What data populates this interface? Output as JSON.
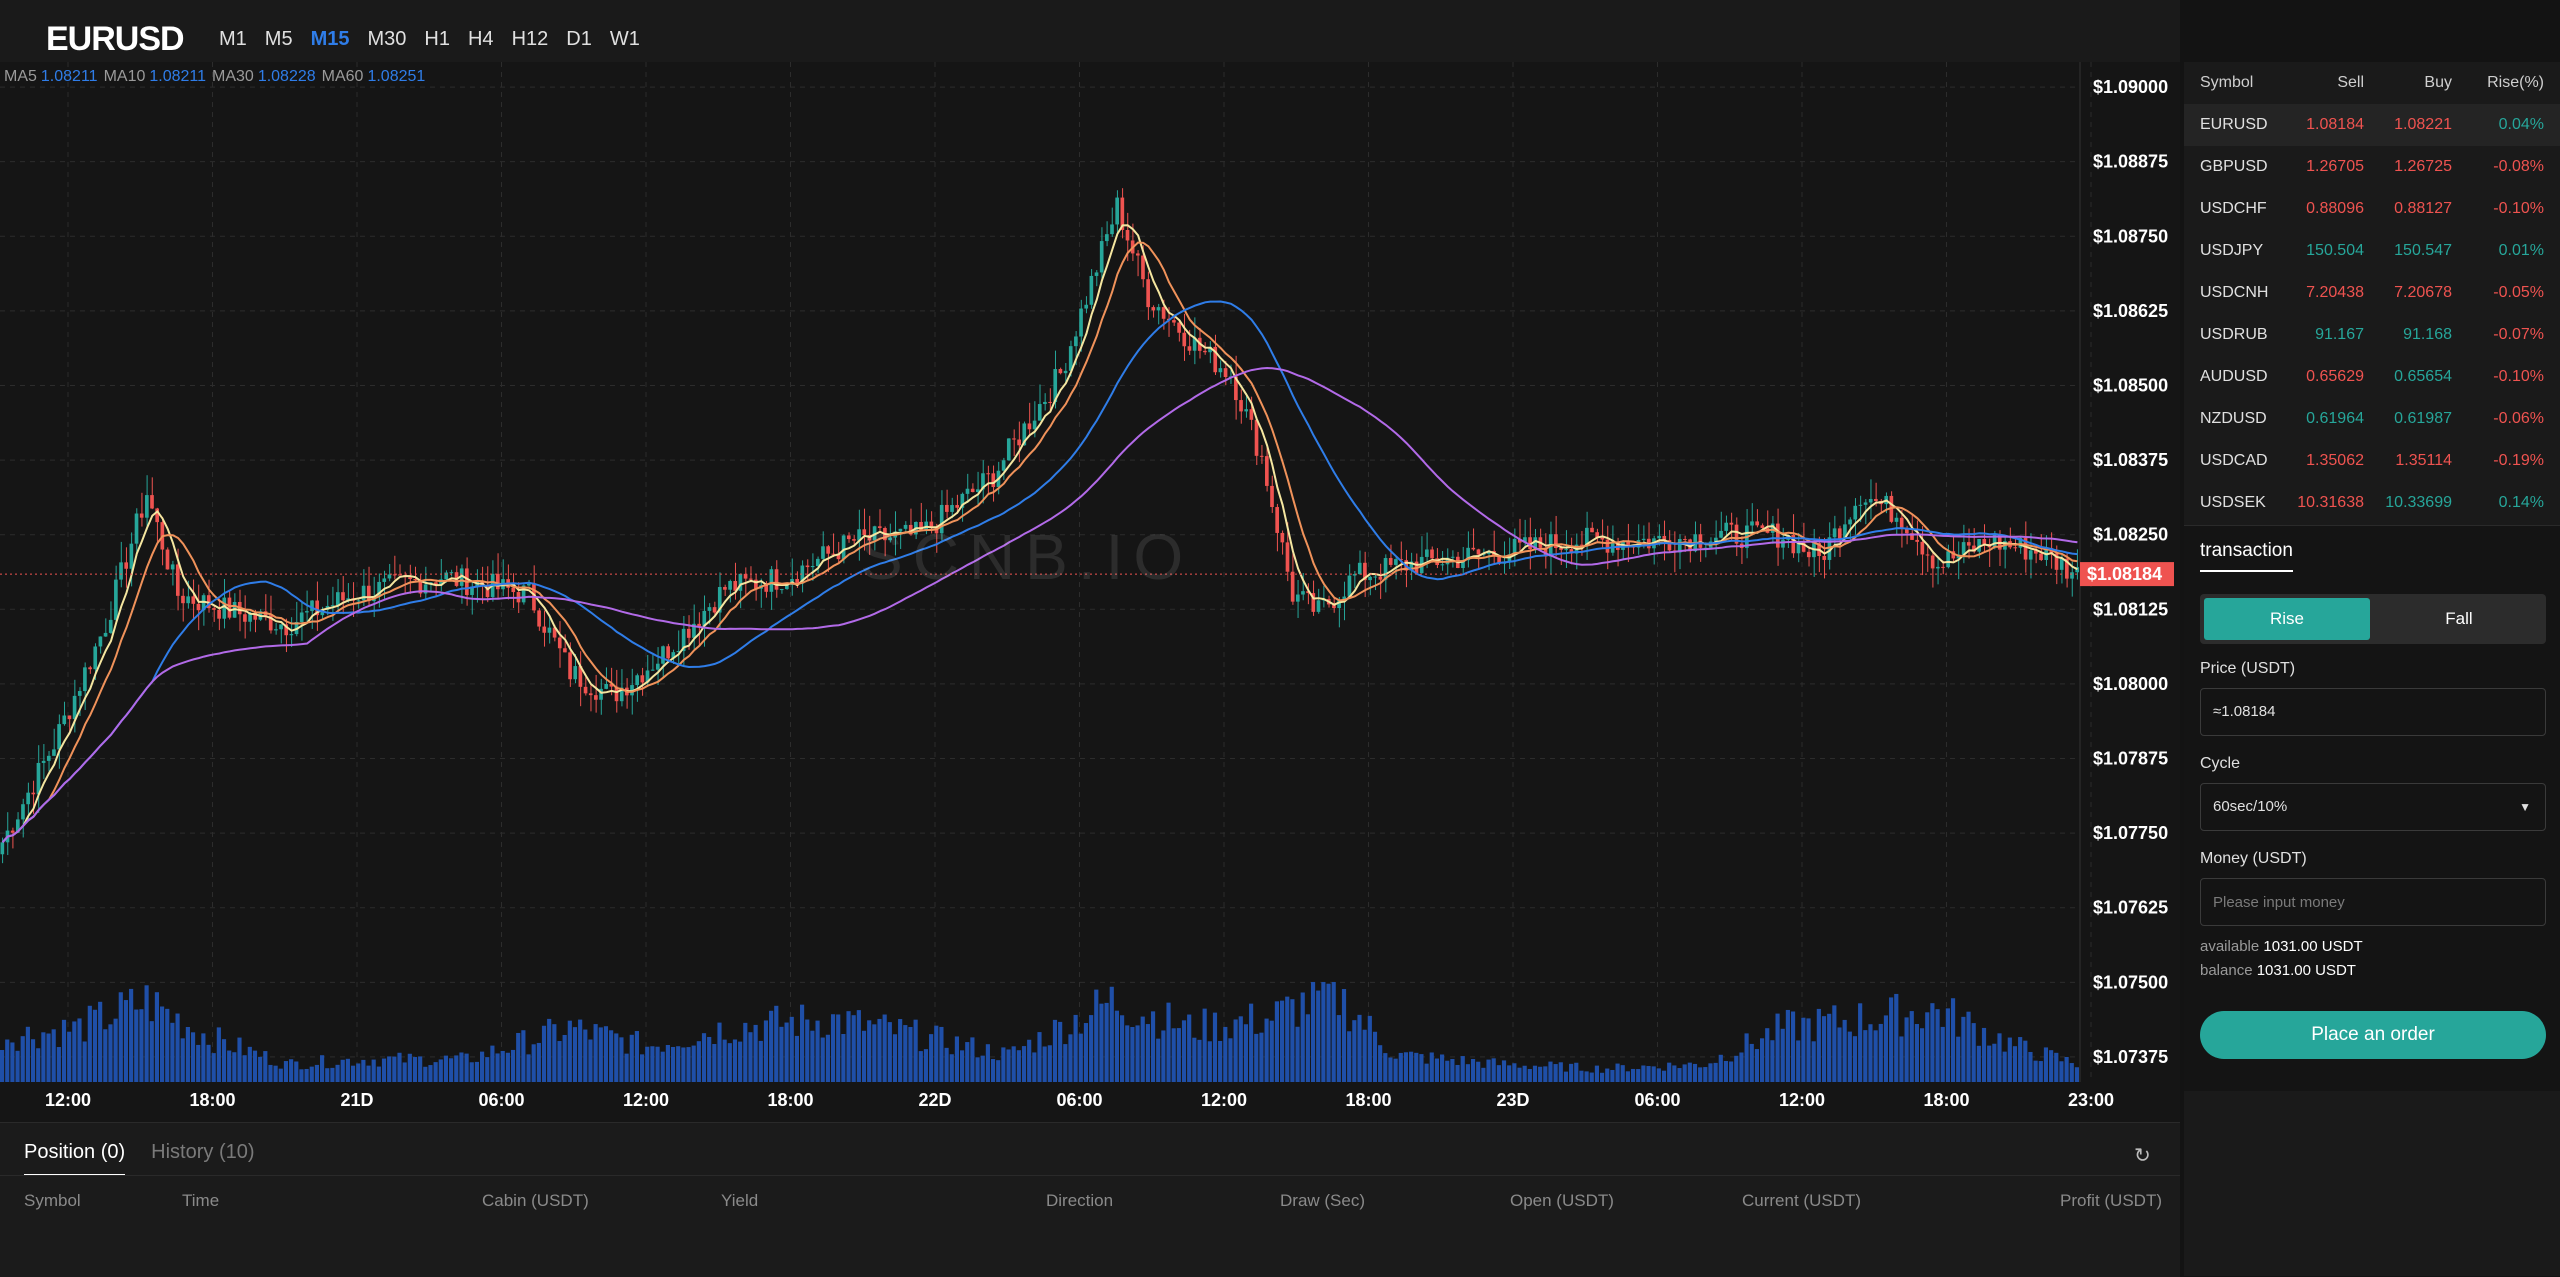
{
  "header": {
    "symbol": "EURUSD",
    "timeframes": [
      "M1",
      "M5",
      "M15",
      "M30",
      "H1",
      "H4",
      "H12",
      "D1",
      "W1"
    ],
    "active_timeframe": "M15"
  },
  "ma_legend": [
    {
      "label": "MA5",
      "value": "1.08211"
    },
    {
      "label": "MA10",
      "value": "1.08211"
    },
    {
      "label": "MA30",
      "value": "1.08228"
    },
    {
      "label": "MA60",
      "value": "1.08251"
    }
  ],
  "watermark": "SCNB.IO",
  "chart_data": {
    "type": "candlestick",
    "symbol": "EURUSD",
    "price_axis_ticks": [
      "$1.09000",
      "$1.08875",
      "$1.08750",
      "$1.08625",
      "$1.08500",
      "$1.08375",
      "$1.08250",
      "$1.08125",
      "$1.08000",
      "$1.07875",
      "$1.07750",
      "$1.07625",
      "$1.07500",
      "$1.07375"
    ],
    "ylim": [
      1.07333,
      1.09042
    ],
    "time_axis_ticks": [
      "12:00",
      "18:00",
      "21D",
      "06:00",
      "12:00",
      "18:00",
      "22D",
      "06:00",
      "12:00",
      "18:00",
      "23D",
      "06:00",
      "12:00",
      "18:00",
      "23:00"
    ],
    "current_price": "$1.08184",
    "close_keypoints": [
      {
        "i": 0,
        "v": 1.07735
      },
      {
        "i": 10,
        "v": 1.079
      },
      {
        "i": 20,
        "v": 1.081
      },
      {
        "i": 28,
        "v": 1.0832
      },
      {
        "i": 34,
        "v": 1.0815
      },
      {
        "i": 45,
        "v": 1.0812
      },
      {
        "i": 55,
        "v": 1.081
      },
      {
        "i": 68,
        "v": 1.0815
      },
      {
        "i": 85,
        "v": 1.0818
      },
      {
        "i": 102,
        "v": 1.0815
      },
      {
        "i": 110,
        "v": 1.0802
      },
      {
        "i": 118,
        "v": 1.0798
      },
      {
        "i": 128,
        "v": 1.0805
      },
      {
        "i": 140,
        "v": 1.0816
      },
      {
        "i": 152,
        "v": 1.0818
      },
      {
        "i": 165,
        "v": 1.0824
      },
      {
        "i": 178,
        "v": 1.0825
      },
      {
        "i": 192,
        "v": 1.0835
      },
      {
        "i": 205,
        "v": 1.0852
      },
      {
        "i": 216,
        "v": 1.088
      },
      {
        "i": 222,
        "v": 1.0865
      },
      {
        "i": 232,
        "v": 1.0856
      },
      {
        "i": 238,
        "v": 1.0852
      },
      {
        "i": 244,
        "v": 1.0838
      },
      {
        "i": 250,
        "v": 1.0815
      },
      {
        "i": 255,
        "v": 1.0812
      },
      {
        "i": 262,
        "v": 1.0818
      },
      {
        "i": 272,
        "v": 1.082
      },
      {
        "i": 290,
        "v": 1.0822
      },
      {
        "i": 305,
        "v": 1.0824
      },
      {
        "i": 320,
        "v": 1.0824
      },
      {
        "i": 335,
        "v": 1.0825
      },
      {
        "i": 345,
        "v": 1.0825
      },
      {
        "i": 352,
        "v": 1.0821
      },
      {
        "i": 360,
        "v": 1.0832
      },
      {
        "i": 368,
        "v": 1.0828
      },
      {
        "i": 375,
        "v": 1.082
      },
      {
        "i": 385,
        "v": 1.0824
      },
      {
        "i": 395,
        "v": 1.0822
      },
      {
        "i": 402,
        "v": 1.08184
      }
    ],
    "volume_keypoints": [
      {
        "i": 0,
        "v": 0.5
      },
      {
        "i": 15,
        "v": 0.6
      },
      {
        "i": 28,
        "v": 0.9
      },
      {
        "i": 40,
        "v": 0.5
      },
      {
        "i": 55,
        "v": 0.2
      },
      {
        "i": 70,
        "v": 0.25
      },
      {
        "i": 90,
        "v": 0.25
      },
      {
        "i": 110,
        "v": 0.6
      },
      {
        "i": 125,
        "v": 0.4
      },
      {
        "i": 140,
        "v": 0.6
      },
      {
        "i": 160,
        "v": 0.7
      },
      {
        "i": 175,
        "v": 0.55
      },
      {
        "i": 195,
        "v": 0.3
      },
      {
        "i": 215,
        "v": 0.9
      },
      {
        "i": 230,
        "v": 0.6
      },
      {
        "i": 245,
        "v": 0.7
      },
      {
        "i": 258,
        "v": 1.0
      },
      {
        "i": 270,
        "v": 0.3
      },
      {
        "i": 290,
        "v": 0.2
      },
      {
        "i": 310,
        "v": 0.15
      },
      {
        "i": 330,
        "v": 0.2
      },
      {
        "i": 345,
        "v": 0.6
      },
      {
        "i": 360,
        "v": 0.7
      },
      {
        "i": 375,
        "v": 0.8
      },
      {
        "i": 390,
        "v": 0.4
      },
      {
        "i": 402,
        "v": 0.2
      }
    ],
    "candle_count": 403,
    "colors": {
      "up": "#26a69a",
      "down": "#ef5350",
      "ma5": "#f5e6a0",
      "ma10": "#f0925a",
      "ma30": "#2f7de8",
      "ma60": "#b26ae8",
      "volume": "#1f4fa8",
      "price_line": "#ef5350"
    }
  },
  "positions": {
    "tabs": [
      {
        "label": "Position (0)"
      },
      {
        "label": "History (10)"
      }
    ],
    "columns": [
      "Symbol",
      "Time",
      "Cabin (USDT)",
      "Yield",
      "Direction",
      "Draw (Sec)",
      "Open (USDT)",
      "Current (USDT)",
      "Profit (USDT)"
    ]
  },
  "market": {
    "headers": [
      "Symbol",
      "Sell",
      "Buy",
      "Rise(%)"
    ],
    "rows": [
      {
        "symbol": "EURUSD",
        "sell": "1.08184",
        "buy": "1.08221",
        "rise": "0.04%",
        "sell_dir": "dn",
        "buy_dir": "dn",
        "rise_dir": "up"
      },
      {
        "symbol": "GBPUSD",
        "sell": "1.26705",
        "buy": "1.26725",
        "rise": "-0.08%",
        "sell_dir": "dn",
        "buy_dir": "dn",
        "rise_dir": "dn"
      },
      {
        "symbol": "USDCHF",
        "sell": "0.88096",
        "buy": "0.88127",
        "rise": "-0.10%",
        "sell_dir": "dn",
        "buy_dir": "dn",
        "rise_dir": "dn"
      },
      {
        "symbol": "USDJPY",
        "sell": "150.504",
        "buy": "150.547",
        "rise": "0.01%",
        "sell_dir": "up",
        "buy_dir": "up",
        "rise_dir": "up"
      },
      {
        "symbol": "USDCNH",
        "sell": "7.20438",
        "buy": "7.20678",
        "rise": "-0.05%",
        "sell_dir": "dn",
        "buy_dir": "dn",
        "rise_dir": "dn"
      },
      {
        "symbol": "USDRUB",
        "sell": "91.167",
        "buy": "91.168",
        "rise": "-0.07%",
        "sell_dir": "up",
        "buy_dir": "up",
        "rise_dir": "dn"
      },
      {
        "symbol": "AUDUSD",
        "sell": "0.65629",
        "buy": "0.65654",
        "rise": "-0.10%",
        "sell_dir": "dn",
        "buy_dir": "up",
        "rise_dir": "dn"
      },
      {
        "symbol": "NZDUSD",
        "sell": "0.61964",
        "buy": "0.61987",
        "rise": "-0.06%",
        "sell_dir": "up",
        "buy_dir": "up",
        "rise_dir": "dn"
      },
      {
        "symbol": "USDCAD",
        "sell": "1.35062",
        "buy": "1.35114",
        "rise": "-0.19%",
        "sell_dir": "dn",
        "buy_dir": "dn",
        "rise_dir": "dn"
      },
      {
        "symbol": "USDSEK",
        "sell": "10.31638",
        "buy": "10.33699",
        "rise": "0.14%",
        "sell_dir": "dn",
        "buy_dir": "up",
        "rise_dir": "up"
      }
    ]
  },
  "trade": {
    "title": "transaction",
    "rise_label": "Rise",
    "fall_label": "Fall",
    "price_label": "Price (USDT)",
    "price_value": "≈1.08184",
    "cycle_label": "Cycle",
    "cycle_value": "60sec/10%",
    "money_label": "Money (USDT)",
    "money_placeholder": "Please input money",
    "available_label": "available",
    "available_value": "1031.00 USDT",
    "balance_label": "balance",
    "balance_value": "1031.00 USDT",
    "order_label": "Place an order"
  }
}
